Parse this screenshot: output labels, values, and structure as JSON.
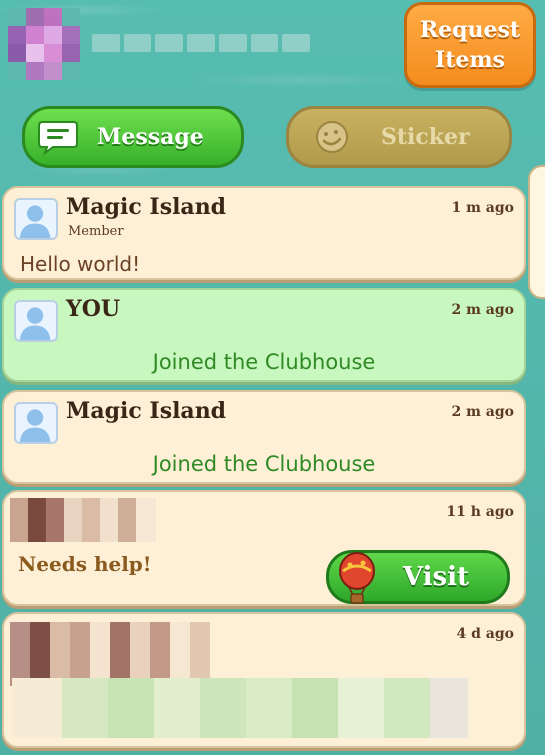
{
  "header": {
    "request_button": "Request\nItems",
    "tabs": {
      "message": "Message",
      "sticker": "Sticker"
    }
  },
  "feed": [
    {
      "name": "Magic Island",
      "role": "Member",
      "time": "1 m ago",
      "message": "Hello world!"
    },
    {
      "name": "YOU",
      "time": "2 m ago",
      "event": "Joined the Clubhouse"
    },
    {
      "name": "Magic Island",
      "time": "2 m ago",
      "event": "Joined the Clubhouse"
    },
    {
      "time": "11 h ago",
      "request_text": "Needs help!",
      "visit_label": "Visit"
    },
    {
      "time": "4 d ago"
    }
  ],
  "colors": {
    "water": "#56b8ad",
    "card": "#fdf0d6",
    "card_highlight": "#c9f7c0",
    "green_button": "#37b02a",
    "orange_button": "#f48c1e",
    "event_text": "#2f8a25"
  },
  "icons": {
    "message": "speech-bubble-icon",
    "sticker": "smiley-face-icon",
    "avatar": "person-silhouette-icon",
    "visit": "hot-air-balloon-icon"
  }
}
